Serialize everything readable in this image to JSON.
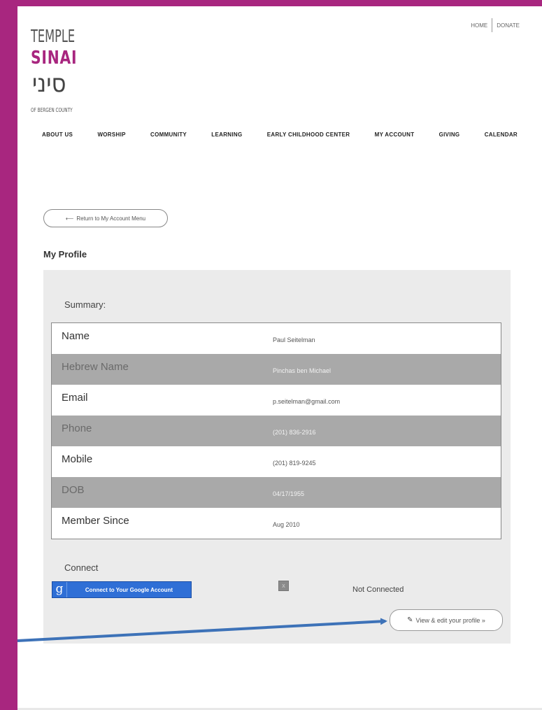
{
  "logo": {
    "line1": "TEMPLE",
    "line2": "SINAI",
    "line3": "סיני",
    "line4": "OF BERGEN COUNTY"
  },
  "util_nav": {
    "home": "HOME",
    "donate": "DONATE"
  },
  "main_nav": {
    "items": [
      "ABOUT US",
      "WORSHIP",
      "COMMUNITY",
      "LEARNING",
      "EARLY CHILDHOOD CENTER",
      "MY ACCOUNT",
      "GIVING",
      "CALENDAR"
    ]
  },
  "return_button": {
    "arrow": "⟵",
    "label": "Return to My Account Menu"
  },
  "page_title": "My Profile",
  "summary": {
    "label": "Summary:",
    "rows": [
      {
        "label": "Name",
        "value": "Paul Seitelman"
      },
      {
        "label": "Hebrew Name",
        "value": "Pinchas ben Michael"
      },
      {
        "label": "Email",
        "value": "p.seitelman@gmail.com"
      },
      {
        "label": "Phone",
        "value": "(201) 836-2916"
      },
      {
        "label": "Mobile",
        "value": "(201) 819-9245"
      },
      {
        "label": "DOB",
        "value": "04/17/1955"
      },
      {
        "label": "Member Since",
        "value": "Aug 2010"
      }
    ]
  },
  "connect": {
    "label": "Connect",
    "google_icon": "g",
    "google_button": "Connect to Your Google Account",
    "remove_icon": "x",
    "status": "Not Connected"
  },
  "edit_button": {
    "icon": "pencil-icon",
    "label": "View & edit your profile »"
  },
  "colors": {
    "frame": "#a8267f",
    "panel": "#ebebeb",
    "alt_row": "#a9a9a9",
    "google_blue": "#2f6fd6",
    "arrow": "#3d72b8"
  }
}
